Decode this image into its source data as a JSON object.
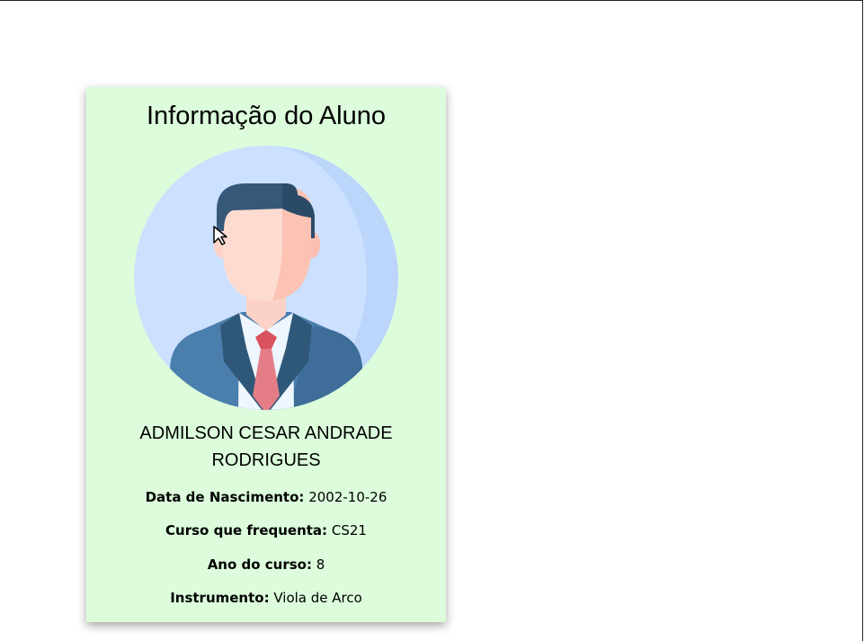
{
  "card": {
    "title": "Informação do Aluno",
    "student_name": "ADMILSON CESAR ANDRADE RODRIGUES",
    "fields": [
      {
        "label": "Data de Nascimento:",
        "value": "2002-10-26"
      },
      {
        "label": "Curso que frequenta:",
        "value": "CS21"
      },
      {
        "label": "Ano do curso:",
        "value": "8"
      },
      {
        "label": "Instrumento:",
        "value": "Viola de Arco"
      }
    ],
    "avatar_icon": "businessman-avatar-icon"
  },
  "colors": {
    "card_background": "#dcfcdc",
    "avatar_background": "#cce0ff",
    "suit": "#4a7fad",
    "tie": "#e0707a"
  }
}
